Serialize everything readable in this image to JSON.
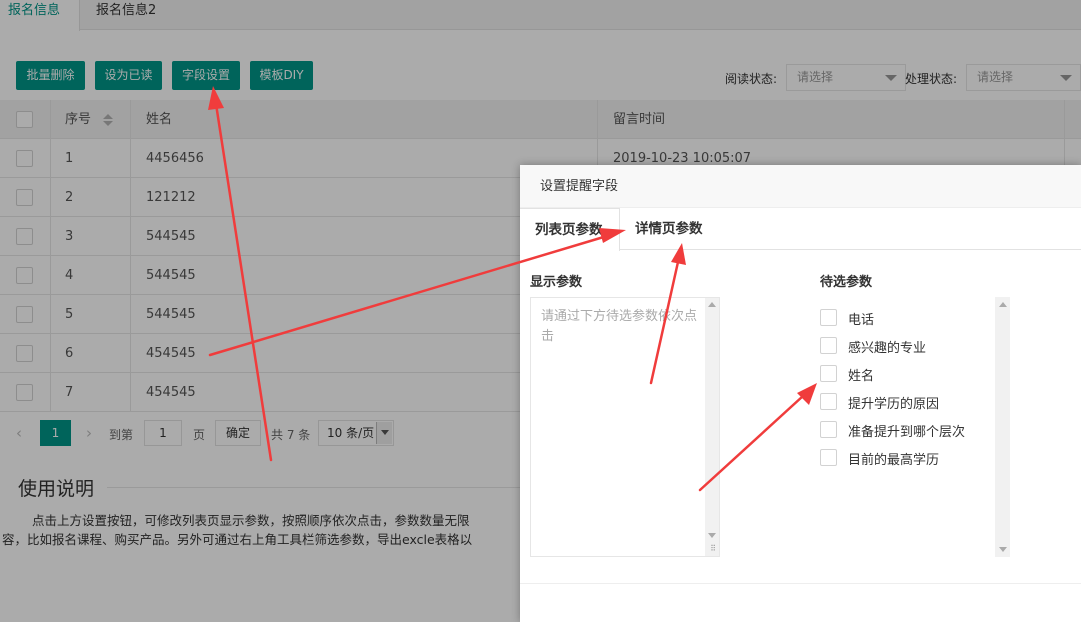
{
  "tabs": [
    {
      "label": "报名信息"
    },
    {
      "label": "报名信息2"
    }
  ],
  "toolbar": {
    "batch_delete": "批量删除",
    "mark_read": "设为已读",
    "field_settings": "字段设置",
    "template_diy": "模板DIY"
  },
  "filters": {
    "read_status_label": "阅读状态:",
    "read_status_value": "请选择",
    "process_status_label": "处理状态:",
    "process_status_value": "请选择"
  },
  "table": {
    "headers": {
      "index": "序号",
      "name": "姓名",
      "time": "留言时间"
    },
    "rows": [
      {
        "index": "1",
        "name": "4456456",
        "time": "2019-10-23 10:05:07"
      },
      {
        "index": "2",
        "name": "121212",
        "time": ""
      },
      {
        "index": "3",
        "name": "544545",
        "time": ""
      },
      {
        "index": "4",
        "name": "544545",
        "time": ""
      },
      {
        "index": "5",
        "name": "544545",
        "time": ""
      },
      {
        "index": "6",
        "name": "454545",
        "time": ""
      },
      {
        "index": "7",
        "name": "454545",
        "time": ""
      }
    ]
  },
  "pager": {
    "current": "1",
    "goto_label": "到第",
    "goto_value": "1",
    "page_unit": "页",
    "confirm": "确定",
    "total": "共 7 条",
    "per_page": "10 条/页"
  },
  "help": {
    "title": "使用说明",
    "line1": "点击上方设置按钮，可修改列表页显示参数，按照顺序依次点击，参数数量无限",
    "line2": "容，比如报名课程、购买产品。另外可通过右上角工具栏筛选参数，导出excle表格以"
  },
  "dialog": {
    "title": "设置提醒字段",
    "tab_list": "列表页参数",
    "tab_detail": "详情页参数",
    "display_title": "显示参数",
    "placeholder": "请通过下方待选参数依次点击",
    "candidate_title": "待选参数",
    "options": [
      {
        "label": "电话"
      },
      {
        "label": "感兴趣的专业"
      },
      {
        "label": "姓名"
      },
      {
        "label": "提升学历的原因"
      },
      {
        "label": "准备提升到哪个层次"
      },
      {
        "label": "目前的最高学历"
      }
    ]
  },
  "colors": {
    "accent": "#009688",
    "arrow": "#f03c3c"
  }
}
